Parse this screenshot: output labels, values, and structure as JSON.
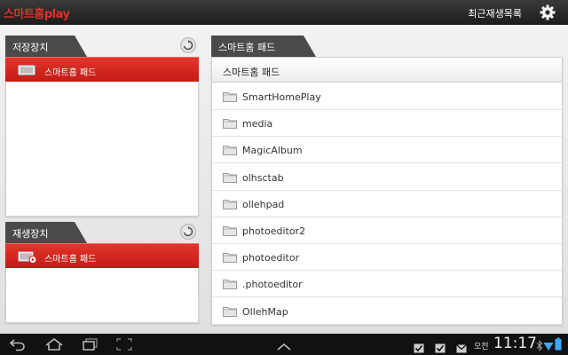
{
  "app": {
    "title": "스마트홈play",
    "recent_label": "최근재생목록",
    "accent_color": "#d8261f"
  },
  "storage_panel": {
    "tab_label": "저장장치",
    "selected_device": "스마트홈 패드"
  },
  "playback_panel": {
    "tab_label": "재생장치",
    "selected_device": "스마트홈 패드"
  },
  "browser": {
    "tab_label": "스마트홈 패드",
    "header": "스마트홈 패드",
    "folders": [
      "SmartHomePlay",
      "media",
      "MagicAlbum",
      "olhsctab",
      "ollehpad",
      "photoeditor2",
      "photoeditor",
      ".photoeditor",
      "OllehMap"
    ]
  },
  "status_bar": {
    "ampm": "오전",
    "time": "11:17"
  }
}
